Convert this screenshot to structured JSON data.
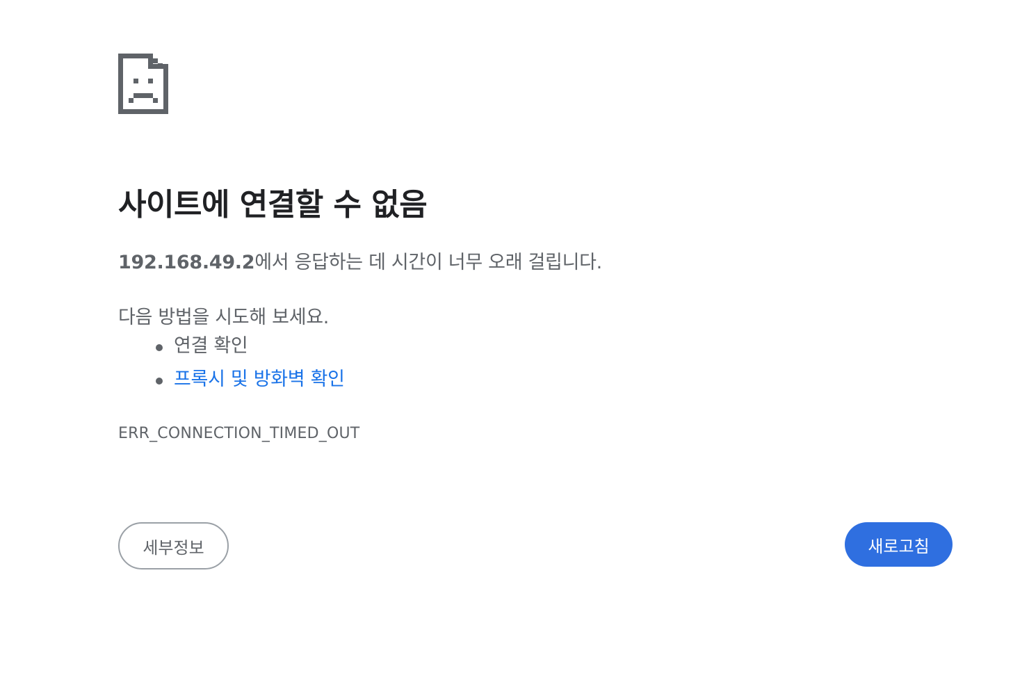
{
  "icon": {
    "name": "sad-page-icon",
    "color": "#5f6368"
  },
  "main": {
    "title": "사이트에 연결할 수 없음",
    "summary_host": "192.168.49.2",
    "summary_text": "에서 응답하는 데 시간이 너무 오래 걸립니다.",
    "suggest_intro": "다음 방법을 시도해 보세요.",
    "suggestions": [
      {
        "label": "연결 확인",
        "is_link": false
      },
      {
        "label": "프록시 및 방화벽 확인",
        "is_link": true
      }
    ],
    "error_code": "ERR_CONNECTION_TIMED_OUT"
  },
  "buttons": {
    "details_label": "세부정보",
    "reload_label": "새로고침"
  },
  "colors": {
    "text_primary": "#202124",
    "text_secondary": "#5f6368",
    "link": "#1a73e8",
    "primary_button": "#2f6fe0"
  }
}
